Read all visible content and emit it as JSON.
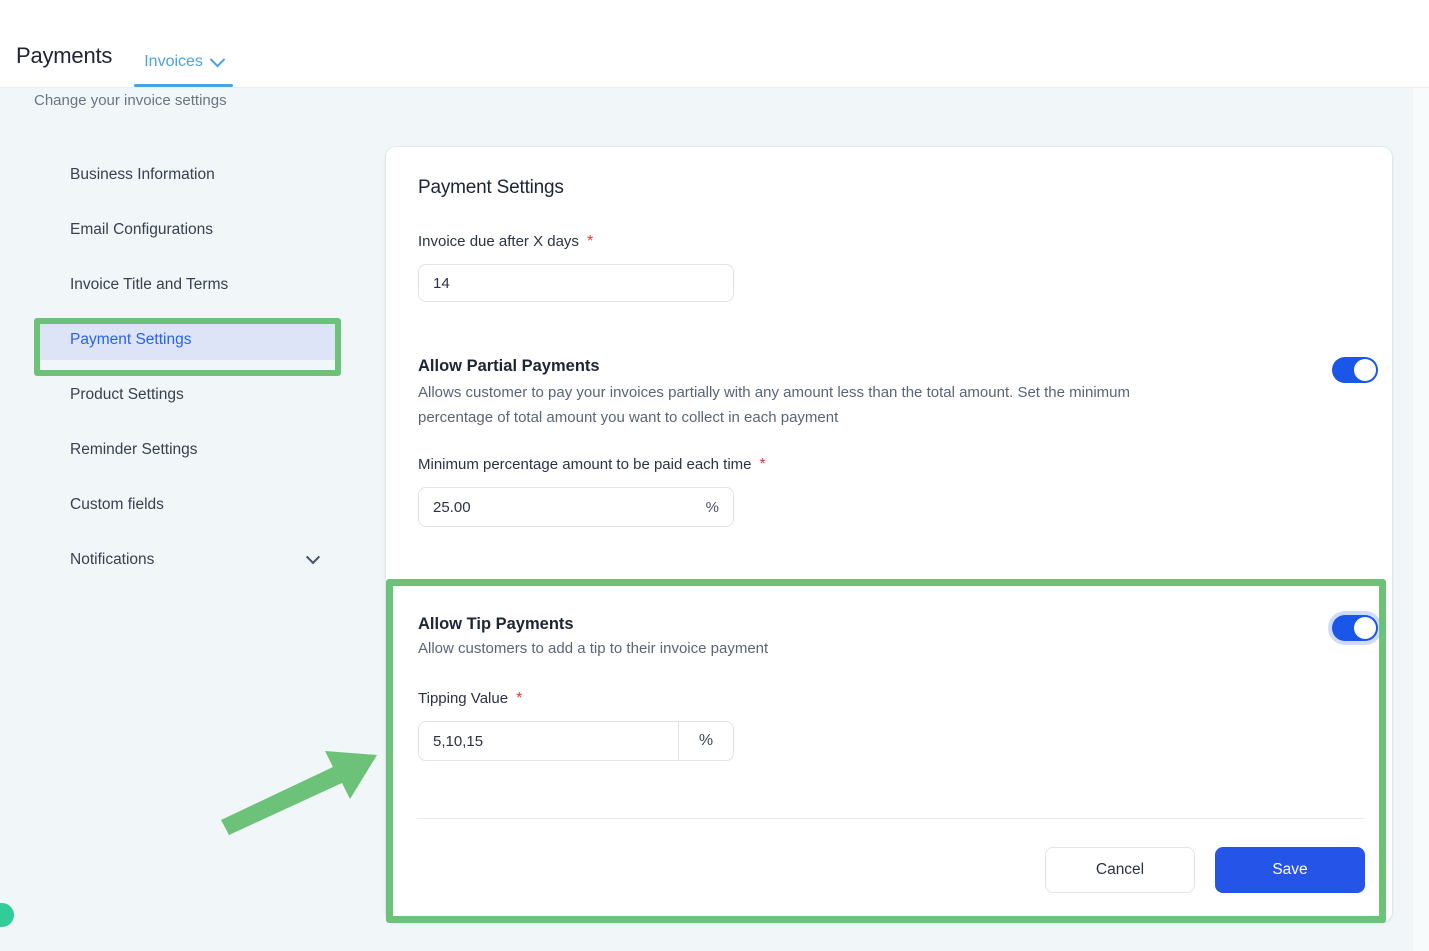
{
  "topbar": {
    "app_title": "Payments",
    "tab_label": "Invoices",
    "tab_chevron_icon": "chevron-down-icon"
  },
  "page": {
    "subtitle": "Change your invoice settings"
  },
  "sidebar": {
    "items": [
      {
        "label": "Business Information",
        "active": false
      },
      {
        "label": "Email Configurations",
        "active": false
      },
      {
        "label": "Invoice Title and Terms",
        "active": false
      },
      {
        "label": "Payment Settings",
        "active": true
      },
      {
        "label": "Product Settings",
        "active": false
      },
      {
        "label": "Reminder Settings",
        "active": false
      },
      {
        "label": "Custom fields",
        "active": false
      },
      {
        "label": "Notifications",
        "active": false,
        "chevron_icon": "chevron-down-icon"
      }
    ]
  },
  "card": {
    "title": "Payment Settings",
    "due_days": {
      "label": "Invoice due after X days",
      "required_marker": "*",
      "value": "14"
    },
    "partial_payments": {
      "heading": "Allow Partial Payments",
      "description": "Allows customer to pay your invoices partially with any amount less than the total amount. Set the minimum percentage of total amount you want to collect in each payment",
      "toggle_state": "on",
      "min_percentage": {
        "label": "Minimum percentage amount to be paid each time",
        "required_marker": "*",
        "value": "25.00",
        "suffix": "%"
      }
    },
    "tip_payments": {
      "heading": "Allow Tip Payments",
      "description": "Allow customers to add a tip to their invoice payment",
      "toggle_state": "on",
      "tipping_value": {
        "label": "Tipping Value",
        "required_marker": "*",
        "value": "5,10,15",
        "suffix": "%"
      }
    },
    "actions": {
      "cancel_label": "Cancel",
      "save_label": "Save"
    }
  },
  "annotations": {
    "highlight_color": "#6cc278",
    "arrow_icon": "arrow-up-right-icon"
  },
  "colors": {
    "accent_blue": "#2554e8",
    "tab_blue": "#4aa3e0",
    "active_nav_bg": "#dde4f7",
    "required_red": "#e03a2f",
    "page_bg": "#f1f6f8"
  }
}
